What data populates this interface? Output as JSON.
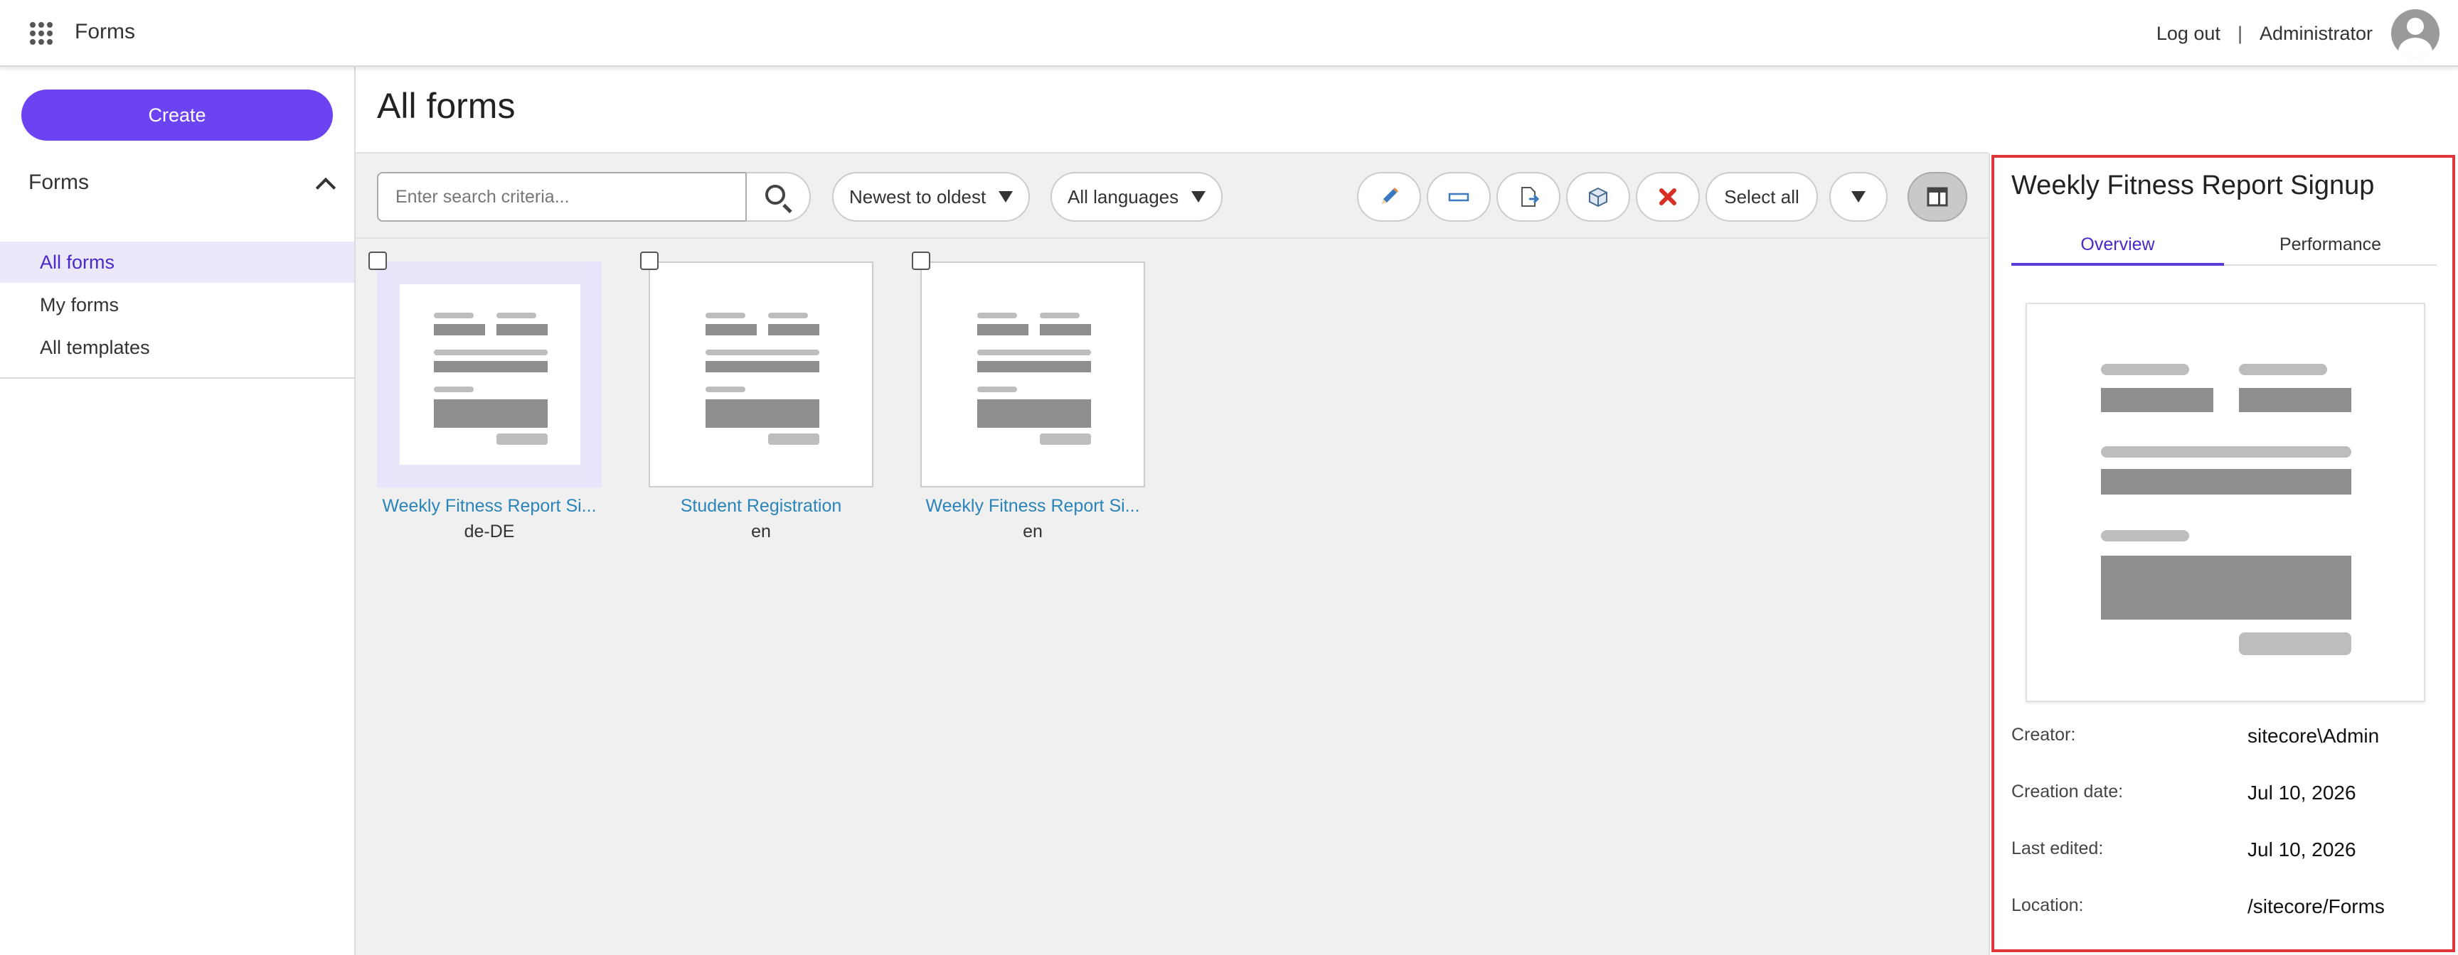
{
  "app": {
    "title": "Forms"
  },
  "topbar": {
    "logout": "Log out",
    "separator": "|",
    "user": "Administrator"
  },
  "sidebar": {
    "create_label": "Create",
    "section_title": "Forms",
    "items": [
      {
        "label": "All forms",
        "active": true
      },
      {
        "label": "My forms",
        "active": false
      },
      {
        "label": "All templates",
        "active": false
      }
    ]
  },
  "main": {
    "title": "All forms"
  },
  "toolbar": {
    "search_placeholder": "Enter search criteria...",
    "sort_label": "Newest to oldest",
    "language_label": "All languages",
    "select_all_label": "Select all",
    "icons": [
      "edit-icon",
      "rename-icon",
      "export-icon",
      "package-icon",
      "delete-icon"
    ]
  },
  "forms": [
    {
      "title": "Weekly Fitness Report Si...",
      "language": "de-DE",
      "selected": true
    },
    {
      "title": "Student Registration",
      "language": "en",
      "selected": false
    },
    {
      "title": "Weekly Fitness Report Si...",
      "language": "en",
      "selected": false
    }
  ],
  "details": {
    "title": "Weekly Fitness Report Signup",
    "tabs": [
      {
        "label": "Overview",
        "active": true
      },
      {
        "label": "Performance",
        "active": false
      }
    ],
    "meta": {
      "creator_label": "Creator:",
      "creator": "sitecore\\Admin",
      "created_label": "Creation date:",
      "created": "Jul 10, 2026",
      "edited_label": "Last edited:",
      "edited": "Jul 10, 2026",
      "location_label": "Location:",
      "location": "/sitecore/Forms"
    }
  },
  "colors": {
    "accent": "#6b43f1",
    "active_nav_bg": "#ebe8fa",
    "link": "#2b84b8",
    "highlight_border": "#e0333a",
    "delete": "#d93025"
  }
}
